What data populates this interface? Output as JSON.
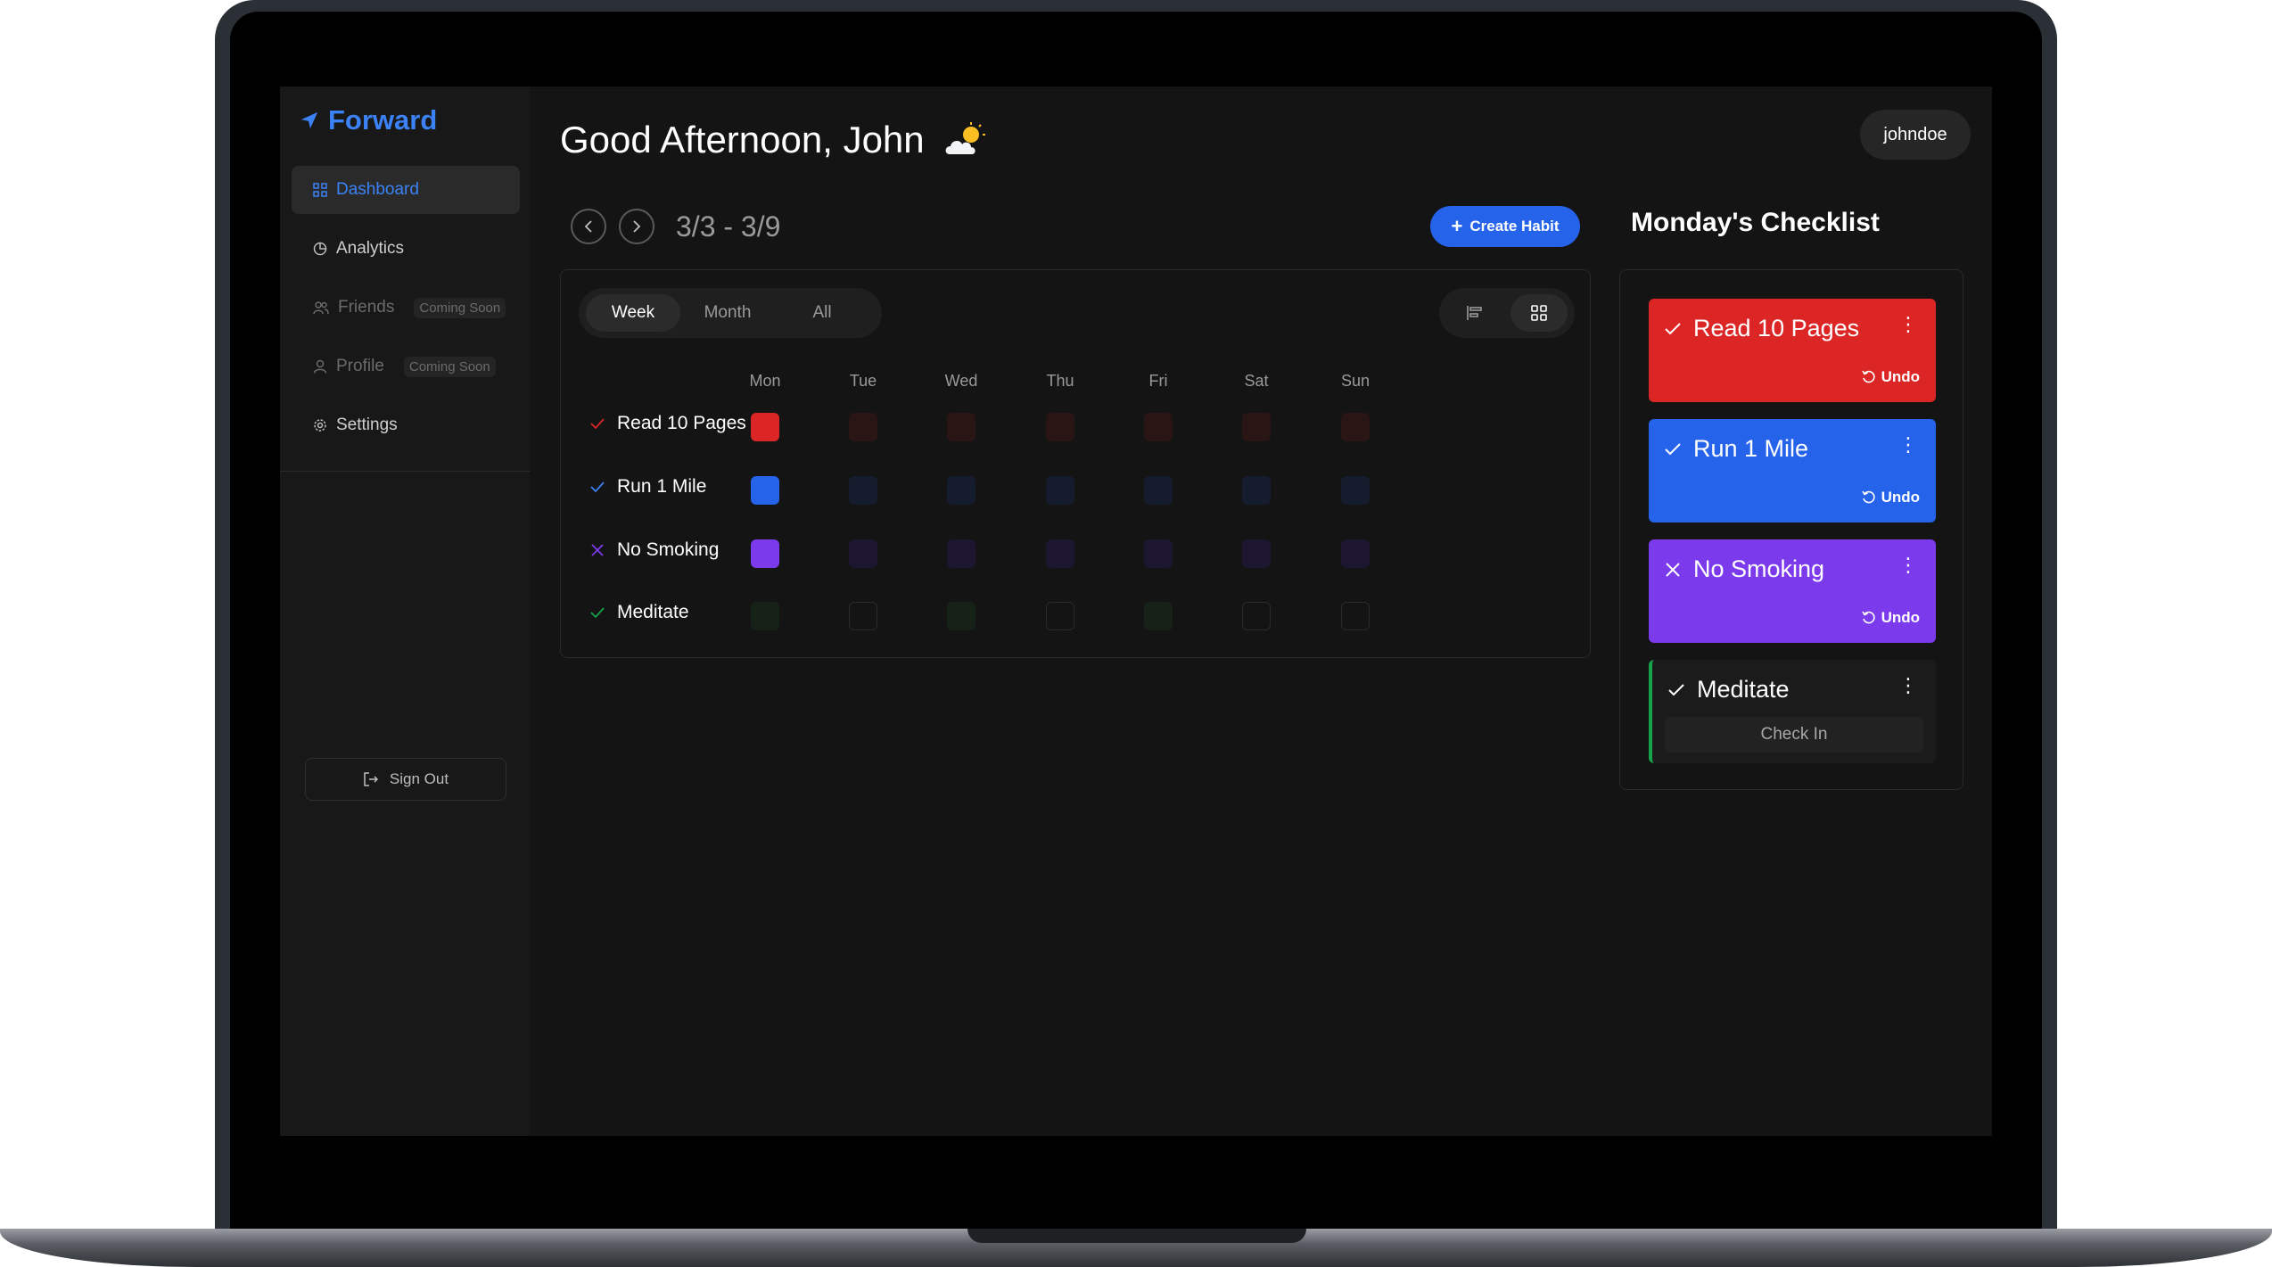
{
  "app": {
    "name": "Forward"
  },
  "sidebar": {
    "items": [
      {
        "label": "Dashboard",
        "icon": "grid-icon",
        "active": true
      },
      {
        "label": "Analytics",
        "icon": "pie-chart-icon"
      },
      {
        "label": "Friends",
        "icon": "users-icon",
        "badge": "Coming Soon"
      },
      {
        "label": "Profile",
        "icon": "user-icon",
        "badge": "Coming Soon"
      },
      {
        "label": "Settings",
        "icon": "gear-icon"
      }
    ],
    "signout_label": "Sign Out"
  },
  "header": {
    "greeting": "Good Afternoon, John",
    "weather_icon": "partly-cloudy-icon",
    "username": "johndoe"
  },
  "week": {
    "range": "3/3 - 3/9",
    "create_label": "Create Habit"
  },
  "view_tabs": [
    "Week",
    "Month",
    "All"
  ],
  "days": [
    "Mon",
    "Tue",
    "Wed",
    "Thu",
    "Fri",
    "Sat",
    "Sun"
  ],
  "habits": [
    {
      "name": "Read 10 Pages",
      "status_icon": "check-icon",
      "color": "#dc2626",
      "dim": "#2a1515",
      "days": [
        1,
        0,
        0,
        0,
        0,
        0,
        0
      ]
    },
    {
      "name": "Run 1 Mile",
      "status_icon": "check-icon",
      "color": "#2563eb",
      "dim": "#151c2e",
      "days": [
        1,
        0,
        0,
        0,
        0,
        0,
        0
      ]
    },
    {
      "name": "No Smoking",
      "status_icon": "x-icon",
      "color": "#7c3aed",
      "dim": "#1c1630",
      "days": [
        1,
        0,
        0,
        0,
        0,
        0,
        0
      ]
    },
    {
      "name": "Meditate",
      "status_icon": "check-icon",
      "color": "#16a34a",
      "dim": "#162218",
      "days": [
        0,
        0,
        0,
        0,
        0,
        0,
        0
      ],
      "pattern": [
        1,
        0,
        1,
        0,
        1,
        0,
        0
      ]
    }
  ],
  "checklist": {
    "title": "Monday's Checklist",
    "items": [
      {
        "name": "Read 10 Pages",
        "action": "Undo",
        "color": "#dc2626"
      },
      {
        "name": "Run 1 Mile",
        "action": "Undo",
        "color": "#2563eb"
      },
      {
        "name": "No Smoking",
        "action": "Undo",
        "color": "#7c3aed"
      },
      {
        "name": "Meditate",
        "action": "Check In",
        "color": "#16a34a"
      }
    ]
  }
}
